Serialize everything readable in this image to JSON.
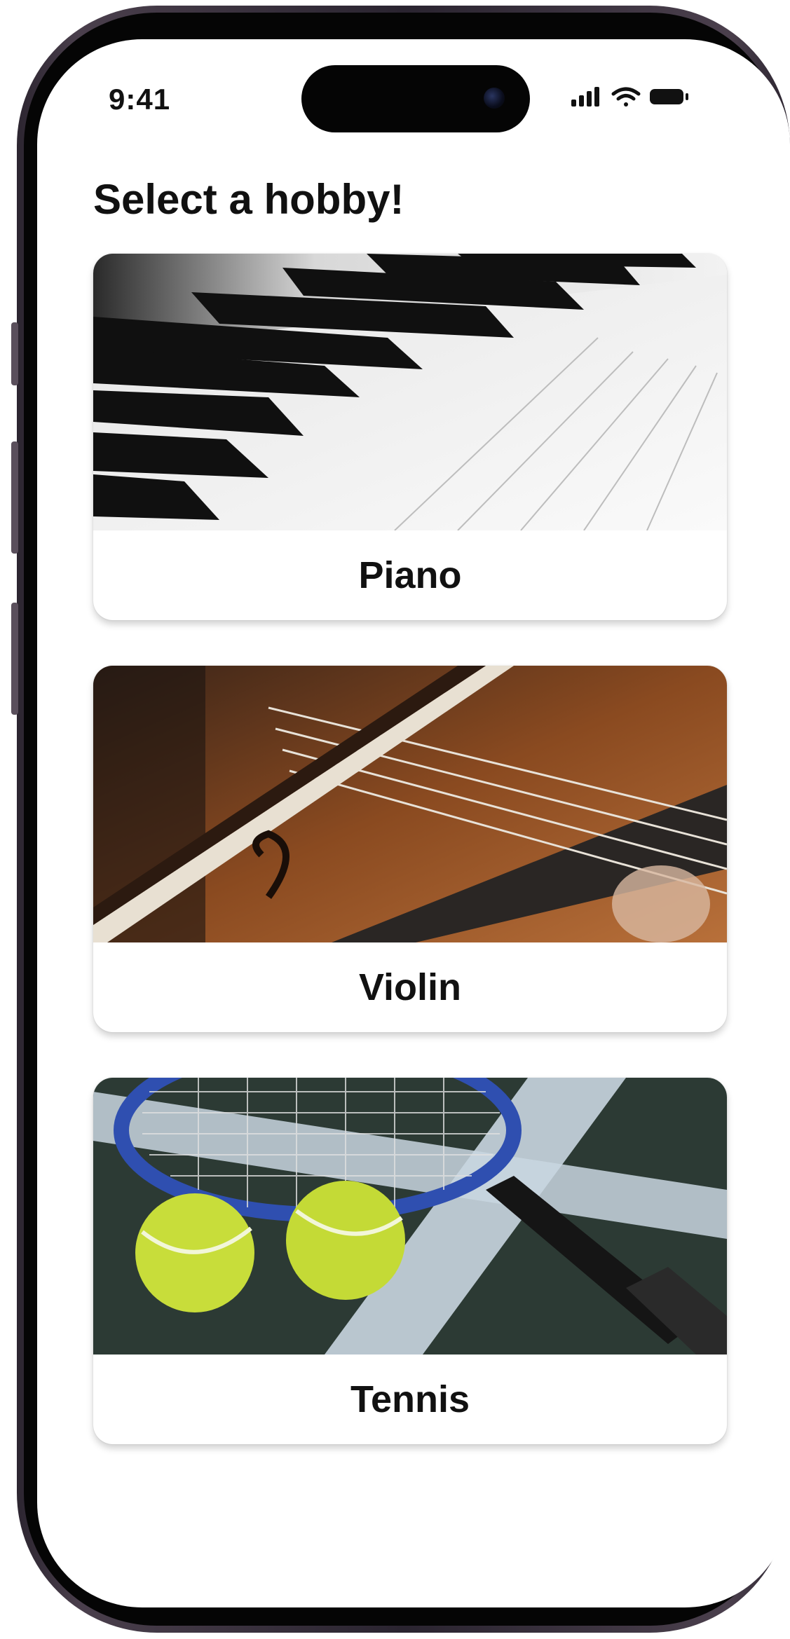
{
  "status_bar": {
    "time": "9:41",
    "icons": [
      "cellular-signal-icon",
      "wifi-icon",
      "battery-icon"
    ]
  },
  "page": {
    "title": "Select a hobby!"
  },
  "hobbies": [
    {
      "label": "Piano",
      "image": "piano-keys-photo"
    },
    {
      "label": "Violin",
      "image": "violin-photo"
    },
    {
      "label": "Tennis",
      "image": "tennis-racket-balls-photo"
    }
  ],
  "colors": {
    "frame": "#3a3140",
    "screen_bg": "#ffffff",
    "text": "#111111"
  }
}
